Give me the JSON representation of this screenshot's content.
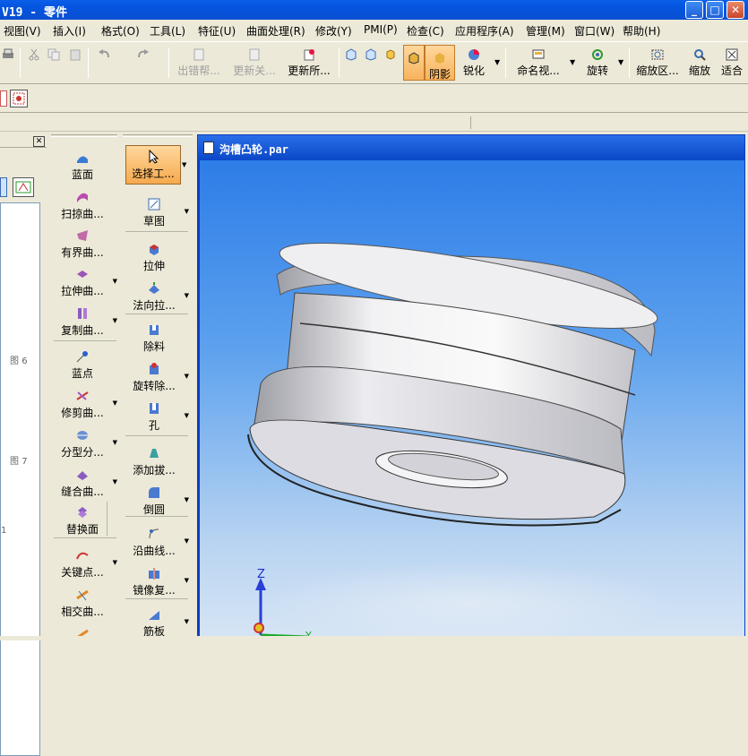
{
  "window": {
    "title": "V19 - 零件"
  },
  "menubar": [
    "视图(V)",
    "插入(I)",
    "格式(O)",
    "工具(L)",
    "特征(U)",
    "曲面处理(R)",
    "修改(Y)",
    "PMI(P)",
    "检查(C)",
    "应用程序(A)",
    "管理(M)",
    "窗口(W)",
    "帮助(H)"
  ],
  "toolbar": {
    "error_help": "出错帮...",
    "update_related": "更新关...",
    "update_all": "更新所...",
    "shading": "阴影",
    "sharpen": "锐化",
    "named_view": "命名视...",
    "rotate": "旋转",
    "zoom_area": "缩放区...",
    "zoom": "缩放",
    "fit": "适合"
  },
  "ribbon_col1": [
    "蓝面",
    "扫掠曲...",
    "有界曲...",
    "拉伸曲...",
    "复制曲...",
    "蓝点",
    "修剪曲...",
    "分型分...",
    "缝合曲...",
    "替换面",
    "关键点...",
    "相交曲...",
    ""
  ],
  "ribbon_col2": [
    "选择工...",
    "草图",
    "拉伸",
    "法向拉...",
    "除料",
    "旋转除...",
    "孔",
    "添加拔...",
    "倒圆",
    "沿曲线...",
    "镜像复...",
    "筋板"
  ],
  "document": {
    "title": "沟槽凸轮.par"
  },
  "axes": {
    "z": "Z",
    "y": "Y"
  },
  "tree": {
    "num1": "6",
    "num2": "7",
    "num3": "1"
  },
  "colors": {
    "titlebar": "#0a5fe8",
    "accent": "#f8b35c",
    "viewport_top": "#2d7de8",
    "part": "#e8e8ec"
  }
}
